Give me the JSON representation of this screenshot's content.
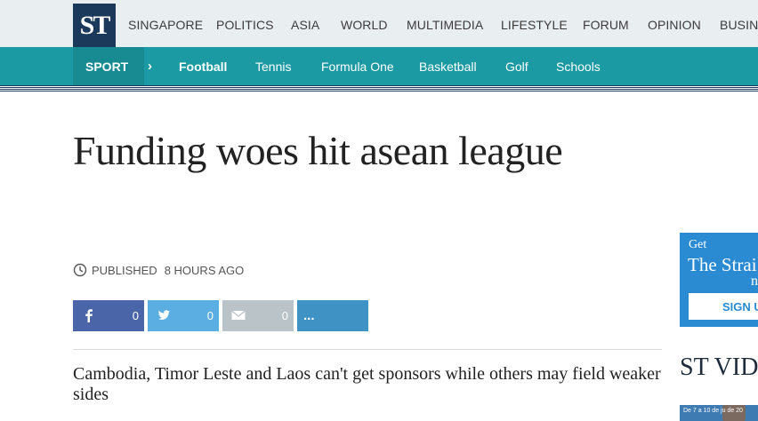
{
  "header": {
    "logo_text": "ST",
    "nav": [
      "SINGAPORE",
      "POLITICS",
      "ASIA",
      "WORLD",
      "MULTIMEDIA",
      "LIFESTYLE",
      "FORUM",
      "OPINION",
      "BUSINE"
    ]
  },
  "subnav": {
    "section": "SPORT",
    "chevron": "›",
    "items": [
      "Football",
      "Tennis",
      "Formula One",
      "Basketball",
      "Golf",
      "Schools"
    ],
    "active": "Football"
  },
  "article": {
    "headline": "Funding woes hit asean league",
    "published_label": "PUBLISHED",
    "published_time": "8 HOURS AGO",
    "standfirst": "Cambodia, Timor Leste and Laos can't get sponsors while others may field weaker sides"
  },
  "share": {
    "facebook_count": "0",
    "twitter_count": "0",
    "email_count": "0",
    "more_label": "..."
  },
  "sidebar": {
    "promo_get": "Get",
    "promo_title": "The Strai",
    "promo_n": "n",
    "signup_label": "SIGN U",
    "video_heading": "ST VID",
    "video_thumb_text": "De 7 a 10 de ju  de 20"
  },
  "colors": {
    "navy": "#1b3a5b",
    "teal": "#1b9aa3",
    "facebook": "#4a66a8",
    "twitter": "#5aaee2",
    "email": "#b9c3c8",
    "more": "#3f92c4",
    "promo_blue": "#2a8bd3"
  }
}
